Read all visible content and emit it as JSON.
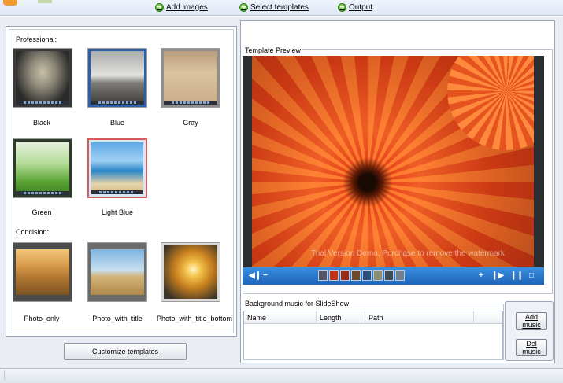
{
  "toolbar": {
    "steps": [
      {
        "label": "Add images",
        "accel": "A"
      },
      {
        "label": "Select templates",
        "accel": "S"
      },
      {
        "label": "Output",
        "accel": "O"
      }
    ]
  },
  "templates": {
    "professional_label": "Professional:",
    "concision_label": "Concision:",
    "professional": [
      {
        "name": "Black",
        "selected": false
      },
      {
        "name": "Blue",
        "selected": false
      },
      {
        "name": "Gray",
        "selected": false
      },
      {
        "name": "Green",
        "selected": false
      },
      {
        "name": "Light Blue",
        "selected": true
      }
    ],
    "concision": [
      {
        "name": "Photo_only"
      },
      {
        "name": "Photo_with_title"
      },
      {
        "name": "Photo_with_title_bottom"
      }
    ],
    "customize_button": "Customize templates"
  },
  "preview": {
    "group_title": "Template Preview",
    "watermark": "Trial Version Demo, Purchase to remove the watermark"
  },
  "music": {
    "group_title": "Background music for SlideShow",
    "columns": [
      "Name",
      "Length",
      "Path"
    ],
    "add_button": "Add music",
    "del_button": "Del music"
  },
  "colors": {
    "accent_blue": "#1f63b8",
    "selection_red": "#d9595c",
    "step_green": "#3aa11d"
  }
}
